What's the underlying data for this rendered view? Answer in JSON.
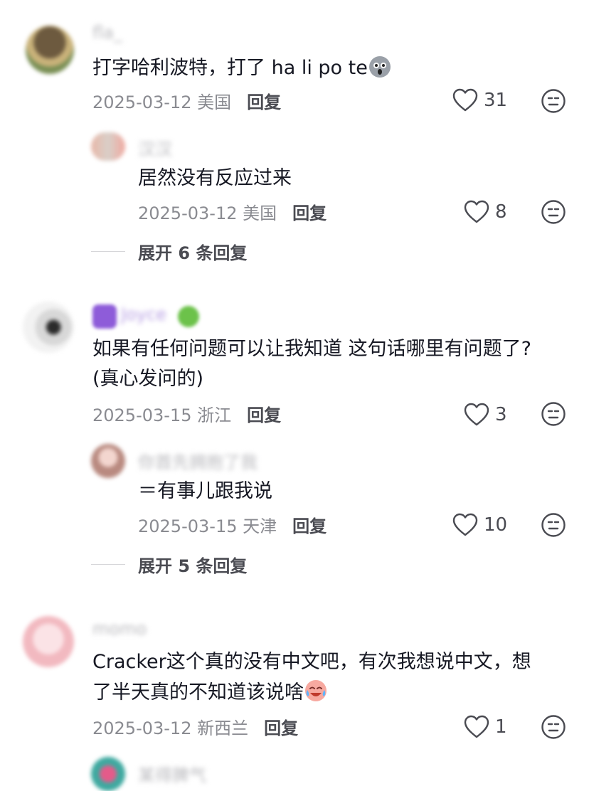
{
  "comments": [
    {
      "user": "fla_",
      "text": "打字哈利波特，打了 ha li po te",
      "emoji": "ghost-face-emoji",
      "date": "2025-03-12",
      "location": "美国",
      "reply_label": "回复",
      "likes": "31",
      "replies": [
        {
          "user": "汉汉",
          "text": "居然没有反应过来",
          "date": "2025-03-12",
          "location": "美国",
          "reply_label": "回复",
          "likes": "8"
        }
      ],
      "expand_label": "展开 6 条回复"
    },
    {
      "user": "Joyce",
      "text_line1": "如果有任何问题可以让我知道 这句话哪里有问题了?",
      "text_line2": "(真心发问的)",
      "date": "2025-03-15",
      "location": "浙江",
      "reply_label": "回复",
      "likes": "3",
      "replies": [
        {
          "user": "你首先拥抱了我",
          "text": "＝有事儿跟我说",
          "date": "2025-03-15",
          "location": "天津",
          "reply_label": "回复",
          "likes": "10"
        }
      ],
      "expand_label": "展开 5 条回复"
    },
    {
      "user": "momo",
      "text_line1": "Cracker这个真的没有中文吧，有次我想说中文，想",
      "text_line2": "了半天真的不知道该说啥",
      "emoji": "crying-laughing-emoji",
      "date": "2025-03-12",
      "location": "新西兰",
      "reply_label": "回复",
      "likes": "1",
      "next_reply_user": "某得脾气"
    }
  ],
  "colors": {
    "text": "#161823",
    "meta": "#8a8b91",
    "action": "#4a4b52",
    "divider": "#d6d6d9"
  },
  "icons": {
    "like": "heart-outline-icon",
    "dislike": "neutral-face-icon"
  }
}
